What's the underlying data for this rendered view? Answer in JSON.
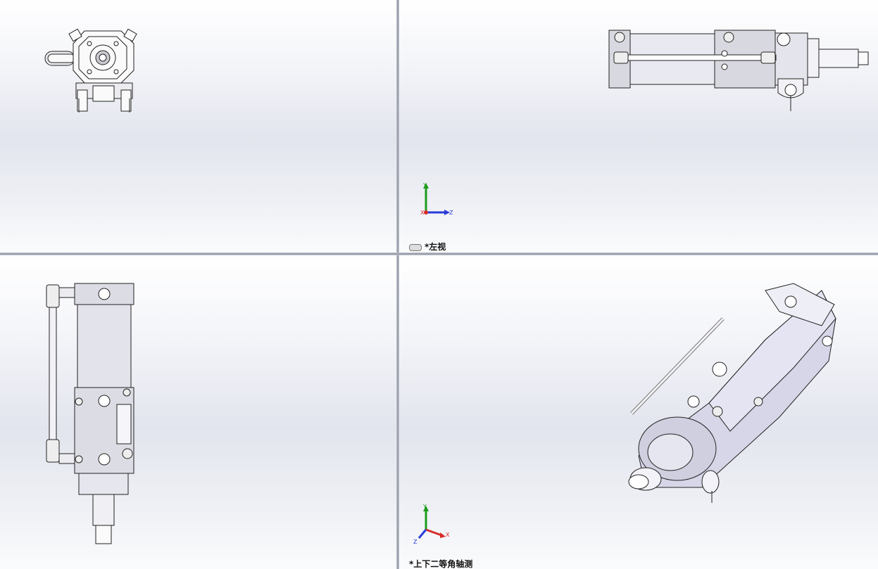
{
  "viewports": {
    "top_left": {
      "label": ""
    },
    "top_right": {
      "label": "*左视",
      "triad": {
        "up": "Y",
        "right": "Z",
        "origin": "X"
      }
    },
    "bottom_left": {
      "label": ""
    },
    "bottom_right": {
      "label": "*上下二等角轴测",
      "triad": {
        "up": "Y",
        "right": "X",
        "origin": "Z"
      }
    }
  },
  "colors": {
    "background_top": "#ffffff",
    "background_mid": "#e3e5ee",
    "divider": "#8d93a1",
    "axis_y": "#1c9c1c",
    "axis_z": "#2a3bd8",
    "axis_x": "#d82a2a"
  }
}
